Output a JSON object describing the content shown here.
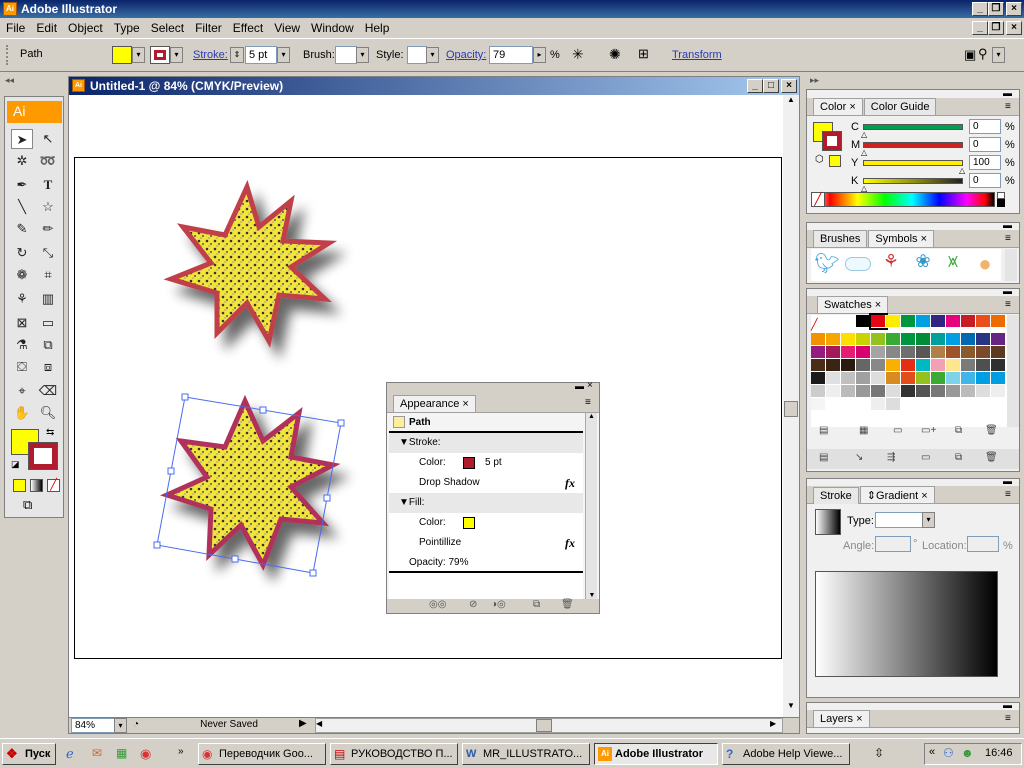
{
  "app": {
    "title": "Adobe Illustrator",
    "icon_text": "Ai"
  },
  "menu": [
    "File",
    "Edit",
    "Object",
    "Type",
    "Select",
    "Filter",
    "Effect",
    "View",
    "Window",
    "Help"
  ],
  "control": {
    "selection": "Path",
    "stroke_label": "Stroke:",
    "stroke_value": "5 pt",
    "brush_label": "Brush:",
    "style_label": "Style:",
    "opacity_label": "Opacity:",
    "opacity_value": "79",
    "percent": "%",
    "transform_label": "Transform",
    "fill_color": "#ffff00",
    "stroke_color": "#b01c2e"
  },
  "document": {
    "title": "Untitled-1 @ 84% (CMYK/Preview)",
    "zoom": "84%",
    "status": "Never Saved"
  },
  "color_panel": {
    "tabs": [
      "Color",
      "Color Guide"
    ],
    "channels": [
      {
        "label": "C",
        "value": "0",
        "unit": "%",
        "color": "#00a050"
      },
      {
        "label": "M",
        "value": "0",
        "unit": "%",
        "color": "#d02020"
      },
      {
        "label": "Y",
        "value": "100",
        "unit": "%",
        "color": "#ffee00"
      },
      {
        "label": "K",
        "value": "0",
        "unit": "%",
        "color": "#202020"
      }
    ]
  },
  "brushes_panel": {
    "tabs": [
      "Brushes",
      "Symbols"
    ]
  },
  "swatches_panel": {
    "tabs": [
      "Swatches"
    ]
  },
  "gradient_panel": {
    "tabs": [
      "Stroke",
      "Gradient"
    ],
    "type_label": "Type:",
    "angle_label": "Angle:",
    "location_label": "Location:",
    "percent": "%"
  },
  "layers_panel": {
    "tabs": [
      "Layers"
    ]
  },
  "appearance": {
    "tab": "Appearance",
    "header": "Path",
    "stroke_label": "Stroke:",
    "stroke_color_label": "Color:",
    "stroke_weight": "5 pt",
    "drop_shadow": "Drop Shadow",
    "fill_label": "Fill:",
    "fill_color_label": "Color:",
    "pointillize": "Pointillize",
    "opacity": "Opacity: 79%",
    "fx": "fx"
  },
  "taskbar": {
    "start": "Пуск",
    "items": [
      {
        "label": "Переводчик Goo...",
        "icon": "chrome-icon"
      },
      {
        "label": "РУКОВОДСТВО П...",
        "icon": "pdf-icon"
      },
      {
        "label": "MR_ILLUSTRATO...",
        "icon": "word-icon"
      },
      {
        "label": "Adobe Illustrator",
        "icon": "illustrator-icon",
        "active": true
      },
      {
        "label": "Adobe Help Viewe...",
        "icon": "help-icon"
      }
    ],
    "clock": "16:46"
  }
}
